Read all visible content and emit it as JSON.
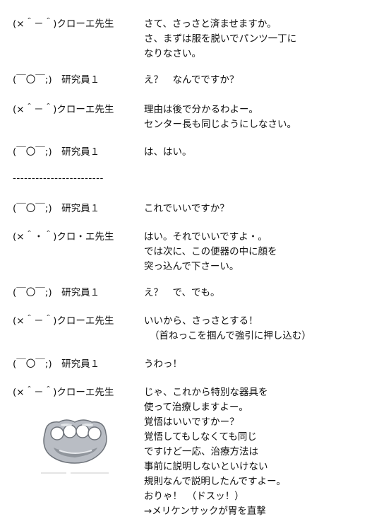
{
  "entries": [
    {
      "speaker": "(×＾－＾)クローエ先生",
      "lines": [
        "さて、さっさと済ませますか。",
        "さ、まずは服を脱いでパンツ一丁に",
        "なりなさい。"
      ]
    },
    {
      "speaker": "(￣〇￣;)　研究員１",
      "lines": [
        "え？　なんでですか？"
      ]
    },
    {
      "speaker": "(×＾－＾)クローエ先生",
      "lines": [
        "理由は後で分かるわよー。",
        "センター長も同じようにしなさい。"
      ]
    },
    {
      "speaker": "(￣〇￣;)　研究員１",
      "lines": [
        "は、はい。"
      ]
    },
    {
      "speaker": "(￣〇￣;)　研究員１",
      "lines": [
        "これでいいですか？"
      ]
    },
    {
      "speaker": "(×＾・＾)クロ・エ先生",
      "lines": [
        "はい。それでいいですよ・。",
        "では次に、この便器の中に顔を",
        "突っ込んで下さーい。"
      ]
    },
    {
      "speaker": "(￣〇￣;)　研究員１",
      "lines": [
        "え？　で、でも。"
      ]
    },
    {
      "speaker": "(×＾－＾)クローエ先生",
      "lines": [
        "いいから、さっさとする！",
        "（首ねっこを掴んで強引に押し込む）"
      ]
    },
    {
      "speaker": "(￣〇￣;)　研究員１",
      "lines": [
        "うわっ！"
      ]
    },
    {
      "speaker": "(×＾－＾)クローエ先生",
      "lines": [
        "じゃ、これから特別な器具を",
        "使って治療しますよー。",
        "覚悟はいいですかー？",
        "覚悟してもしなくても同じ",
        "ですけど一応、治療方法は",
        "事前に説明しないといけない",
        "規則なんで説明したんですよー。",
        "おりゃ！　（ドスッ！）",
        "→メリケンサックが胃を直撃"
      ]
    }
  ],
  "divider": "------------------------",
  "image": {
    "icon": "brass-knuckles-icon",
    "metal": "#b9bdc4",
    "shadow": "#6f747b"
  }
}
